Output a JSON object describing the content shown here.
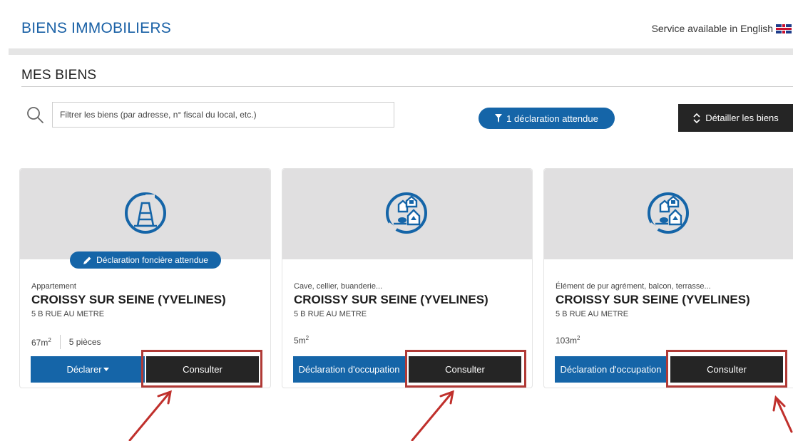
{
  "header": {
    "app_title": "BIENS IMMOBILIERS",
    "english_link": "Service available in English"
  },
  "section": {
    "title": "MES BIENS"
  },
  "search": {
    "placeholder": "Filtrer les biens (par adresse, n° fiscal du local, etc.)"
  },
  "filters": {
    "pending_label": "1 déclaration attendue",
    "detail_label": "Détailler les biens"
  },
  "cards": [
    {
      "badge": "Déclaration foncière attendue",
      "type": "Appartement",
      "city": "CROISSY SUR SEINE (YVELINES)",
      "address": "5 B RUE AU METRE",
      "area": "67m",
      "area_exp": "2",
      "rooms": "5 pièces",
      "left_button": "Déclarer",
      "consult_button": "Consulter",
      "icon": "building-icon"
    },
    {
      "type": "Cave, cellier, buanderie...",
      "city": "CROISSY SUR SEINE (YVELINES)",
      "address": "5 B RUE AU METRE",
      "area": "5m",
      "area_exp": "2",
      "left_button": "Déclaration d'occupation",
      "consult_button": "Consulter",
      "icon": "outbuildings-icon"
    },
    {
      "type": "Élément de pur agrément, balcon, terrasse...",
      "city": "CROISSY SUR SEINE (YVELINES)",
      "address": "5 B RUE AU METRE",
      "area": "103m",
      "area_exp": "2",
      "left_button": "Déclaration d'occupation",
      "consult_button": "Consulter",
      "icon": "outbuildings-icon"
    }
  ],
  "colors": {
    "brand_blue": "#1565a8",
    "title_blue": "#1a61a6",
    "dark_button": "#252525",
    "highlight_red": "#b03a36"
  }
}
